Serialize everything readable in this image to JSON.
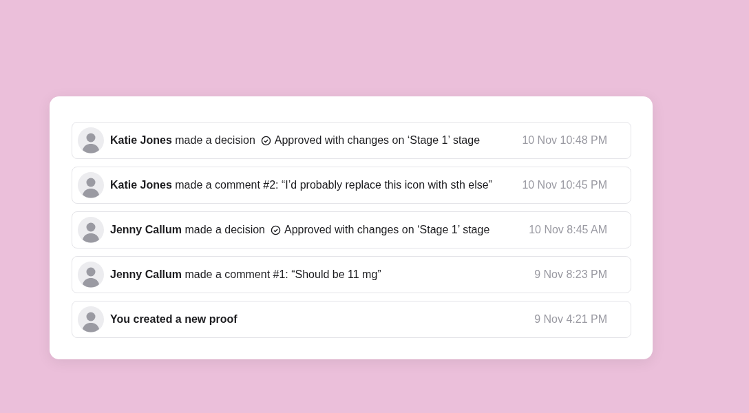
{
  "activity": [
    {
      "kind": "decision",
      "text": "**Katie Jones** made a decision",
      "decision": "Approved with changes on ‘Stage 1’ stage",
      "time": "10 Nov 10:48 PM"
    },
    {
      "kind": "comment",
      "text": "**Katie Jones** made a comment #2: “I’d probably replace this icon with sth else”",
      "time": "10 Nov 10:45 PM"
    },
    {
      "kind": "decision",
      "text": "**Jenny Callum** made a decision",
      "decision": "Approved with changes on ‘Stage 1’ stage",
      "time": "10 Nov 8:45 AM"
    },
    {
      "kind": "comment",
      "text": "**Jenny Callum** made a comment #1: “Should be 11 mg”",
      "time": "9 Nov 8:23 PM"
    },
    {
      "kind": "created",
      "text": "You created a new proof",
      "time": "9 Nov 4:21 PM"
    }
  ]
}
